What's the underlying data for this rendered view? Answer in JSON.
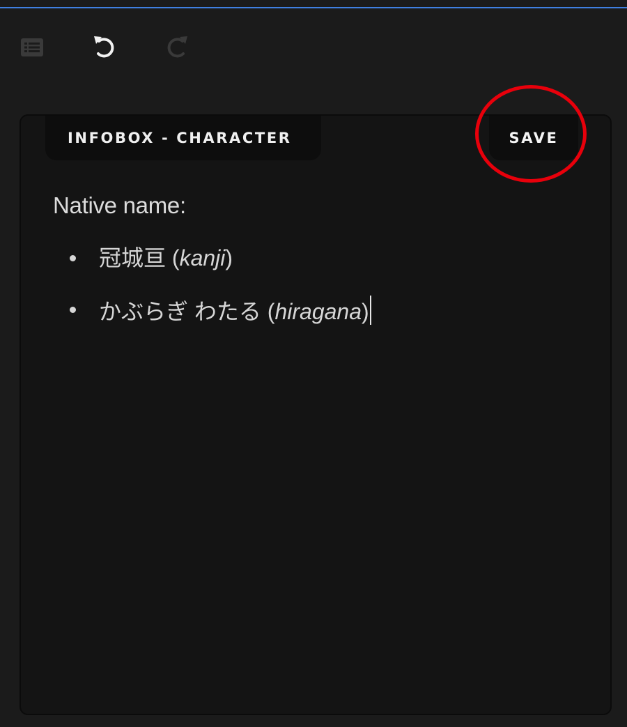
{
  "toolbar": {
    "buttons": [
      {
        "icon": "list-icon",
        "enabled": false
      },
      {
        "icon": "undo-icon",
        "enabled": true
      },
      {
        "icon": "redo-icon",
        "enabled": false
      }
    ]
  },
  "panel": {
    "title": "INFOBOX - CHARACTER",
    "save_label": "SAVE",
    "highlight_color": "#e8000b"
  },
  "field": {
    "label": "Native name:",
    "values": [
      {
        "text": "冠城亘",
        "note": "kanji"
      },
      {
        "text": "かぶらぎ わたる",
        "note": "hiragana"
      }
    ]
  },
  "colors": {
    "accent": "#3f7fe0",
    "background": "#1b1b1b",
    "panel": "#141414"
  }
}
